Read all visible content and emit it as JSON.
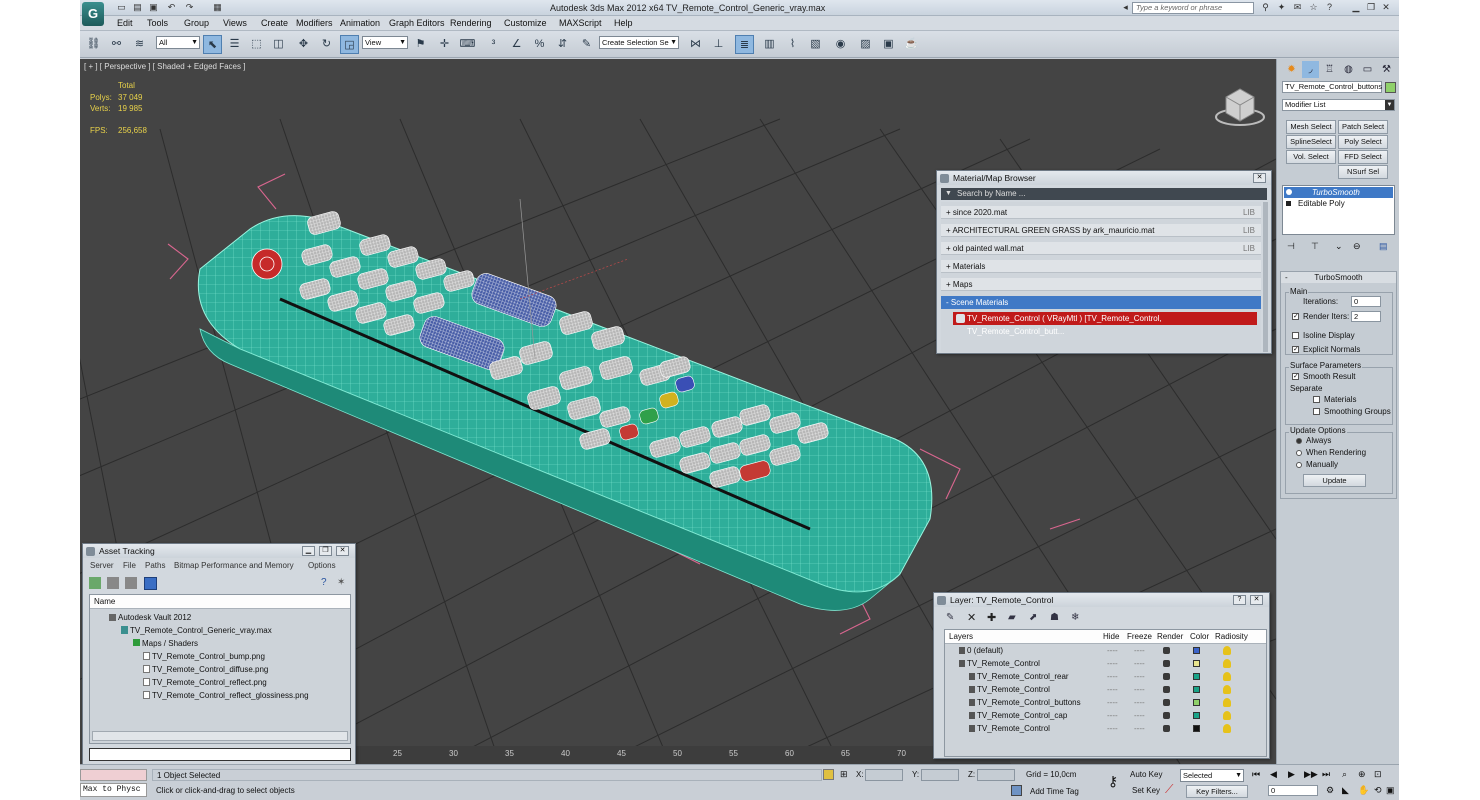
{
  "app": {
    "title": "Autodesk 3ds Max  2012 x64      TV_Remote_Control_Generic_vray.max",
    "logo": "G",
    "search_placeholder": "Type a keyword or phrase"
  },
  "menu": [
    "Edit",
    "Tools",
    "Group",
    "Views",
    "Create",
    "Modifiers",
    "Animation",
    "Graph Editors",
    "Rendering",
    "Customize",
    "MAXScript",
    "Help"
  ],
  "toolbar": {
    "selection_filter": "All",
    "ref_coord": "View",
    "named_selection": "Create Selection Se"
  },
  "viewport": {
    "label": "[ + ] [ Perspective ] [ Shaded + Edged Faces ]",
    "stats": {
      "total_label": "Total",
      "polys_label": "Polys:",
      "polys_value": "37 049",
      "verts_label": "Verts:",
      "verts_value": "19 985",
      "fps_label": "FPS:",
      "fps_value": "256,658"
    },
    "ruler_ticks": [
      "25",
      "30",
      "35",
      "40",
      "45",
      "50",
      "55",
      "60",
      "65",
      "70"
    ]
  },
  "command_panel": {
    "object_name": "TV_Remote_Control_buttons",
    "object_color": "#8fd16a",
    "modifier_list": "Modifier List",
    "buttons": [
      "Mesh Select",
      "Patch Select",
      "SplineSelect",
      "Poly Select",
      "Vol. Select",
      "FFD Select",
      "NSurf Sel"
    ],
    "stack": [
      "TurboSmooth",
      "Editable Poly"
    ],
    "rollout_title": "TurboSmooth",
    "main_label": "Main",
    "iterations_label": "Iterations:",
    "iterations_value": "0",
    "render_iters_label": "Render Iters:",
    "render_iters_value": "2",
    "isoline_label": "Isoline Display",
    "explicit_label": "Explicit Normals",
    "surface_label": "Surface Parameters",
    "smooth_result_label": "Smooth Result",
    "separate_label": "Separate",
    "materials_label": "Materials",
    "smoothing_groups_label": "Smoothing Groups",
    "update_options_label": "Update Options",
    "always_label": "Always",
    "when_rendering_label": "When Rendering",
    "manually_label": "Manually",
    "update_button": "Update"
  },
  "material_browser": {
    "title": "Material/Map Browser",
    "search_placeholder": "Search by Name ...",
    "rows": [
      {
        "label": "+ since 2020.mat",
        "tag": "LIB"
      },
      {
        "label": "+ ARCHITECTURAL GREEN GRASS by ark_mauricio.mat",
        "tag": "LIB"
      },
      {
        "label": "+ old painted wall.mat",
        "tag": "LIB"
      },
      {
        "label": "+ Materials",
        "tag": ""
      },
      {
        "label": "+ Maps",
        "tag": ""
      },
      {
        "label": "- Scene Materials",
        "tag": ""
      }
    ],
    "scene_material": "TV_Remote_Control  ( VRayMtl )  [TV_Remote_Control, TV_Remote_Control_butt..."
  },
  "asset_tracking": {
    "title": "Asset Tracking",
    "menu": [
      "Server",
      "File",
      "Paths",
      "Bitmap Performance and Memory",
      "Options"
    ],
    "column": "Name",
    "tree": [
      {
        "label": "Autodesk Vault 2012",
        "indent": 1
      },
      {
        "label": "TV_Remote_Control_Generic_vray.max",
        "indent": 2
      },
      {
        "label": "Maps / Shaders",
        "indent": 3
      },
      {
        "label": "TV_Remote_Control_bump.png",
        "indent": 4
      },
      {
        "label": "TV_Remote_Control_diffuse.png",
        "indent": 4
      },
      {
        "label": "TV_Remote_Control_reflect.png",
        "indent": 4
      },
      {
        "label": "TV_Remote_Control_reflect_glossiness.png",
        "indent": 4
      }
    ]
  },
  "layer_window": {
    "title": "Layer: TV_Remote_Control",
    "columns": [
      "Layers",
      "Hide",
      "Freeze",
      "Render",
      "Color",
      "Radiosity"
    ],
    "rows": [
      {
        "name": "0 (default)",
        "indent": 1,
        "color": "#3b63c9"
      },
      {
        "name": "TV_Remote_Control",
        "indent": 1,
        "color": "#e9e58f"
      },
      {
        "name": "TV_Remote_Control_rear",
        "indent": 2,
        "color": "#1aa388"
      },
      {
        "name": "TV_Remote_Control",
        "indent": 2,
        "color": "#1aa388"
      },
      {
        "name": "TV_Remote_Control_buttons",
        "indent": 2,
        "color": "#8fd16a"
      },
      {
        "name": "TV_Remote_Control_cap",
        "indent": 2,
        "color": "#1aa388"
      },
      {
        "name": "TV_Remote_Control",
        "indent": 2,
        "color": "#111111"
      }
    ]
  },
  "status": {
    "maxscript": "Max to Physc",
    "selected": "1 Object Selected",
    "prompt": "Click or click-and-drag to select objects",
    "x_label": "X:",
    "y_label": "Y:",
    "z_label": "Z:",
    "grid": "Grid = 10,0cm",
    "add_time_tag": "Add Time Tag",
    "auto_key": "Auto Key",
    "set_key": "Set Key",
    "selected_dropdown": "Selected",
    "key_filters": "Key Filters...",
    "frame": "0"
  }
}
